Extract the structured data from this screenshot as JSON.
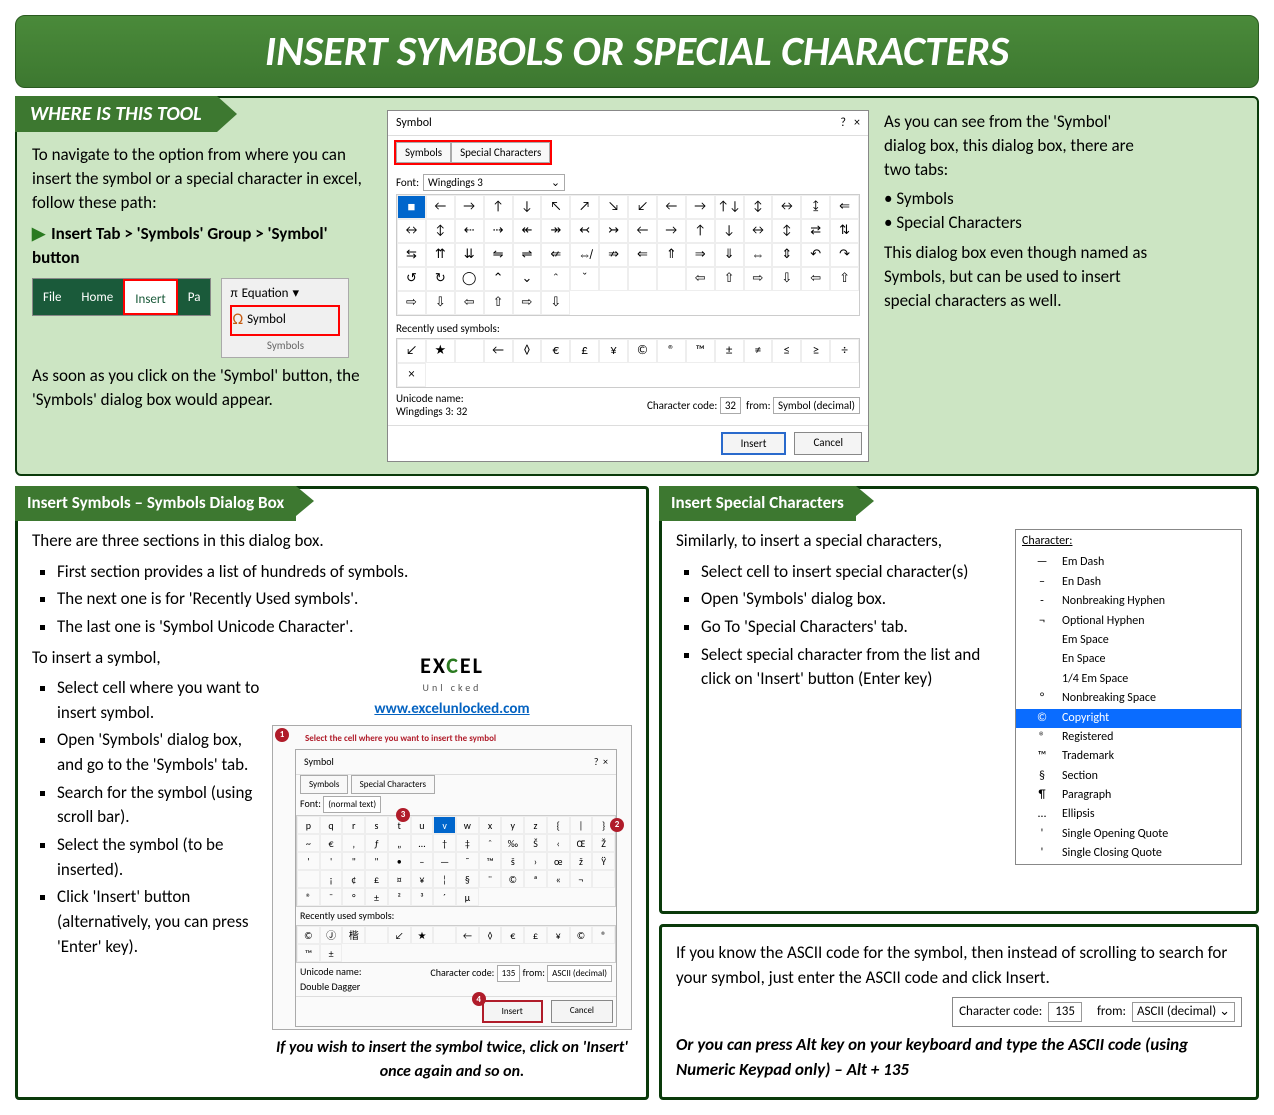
{
  "title": "INSERT SYMBOLS OR SPECIAL CHARACTERS",
  "where": {
    "header": "WHERE IS THIS TOOL",
    "intro": "To navigate to the option from where you can insert the symbol or a special character in excel, follow these path:",
    "path": "Insert Tab > 'Symbols' Group > 'Symbol' button",
    "after": "As soon as you click on the 'Symbol' button, the 'Symbols' dialog box would appear.",
    "ribbon": {
      "file": "File",
      "home": "Home",
      "insert": "Insert",
      "pa": "Pa"
    },
    "group": {
      "equation": "Equation",
      "symbol": "Symbol",
      "label": "Symbols",
      "pi": "π",
      "omega": "Ω"
    },
    "right_intro": "As you can see from the 'Symbol' dialog box, this dialog box, there are two tabs:",
    "bullets": [
      "Symbols",
      "Special Characters"
    ],
    "right_after": "This dialog box even though named as Symbols, but can be used to insert special characters as well."
  },
  "dialog": {
    "title": "Symbol",
    "help": "?",
    "close": "×",
    "tab1": "Symbols",
    "tab2": "Special Characters",
    "font_label": "Font:",
    "font_value": "Wingdings 3",
    "grid": [
      "■",
      "←",
      "→",
      "↑",
      "↓",
      "↖",
      "↗",
      "↘",
      "↙",
      "←",
      "→",
      "↑↓",
      "↕",
      "↔",
      "↨",
      "⇐",
      "↔",
      "↕",
      "⇠",
      "⇢",
      "↞",
      "↠",
      "↢",
      "↣",
      "←",
      "→",
      "↑",
      "↓",
      "↔",
      "↕",
      "⇄",
      "⇅",
      "⇆",
      "⇈",
      "⇊",
      "⇋",
      "⇌",
      "⇍",
      "⇎",
      "⇏",
      "⇐",
      "⇑",
      "⇒",
      "⇓",
      "⇔",
      "⇕",
      "↶",
      "↷",
      "↺",
      "↻",
      "◯",
      "⌃",
      "⌄",
      "＾",
      "ˇ",
      "",
      "",
      "",
      "⇦",
      "⇧",
      "⇨",
      "⇩",
      "⇦",
      "⇧",
      "⇨",
      "⇩",
      "⇦",
      "⇧",
      "⇨",
      "⇩"
    ],
    "recent_label": "Recently used symbols:",
    "recent": [
      "↙",
      "★",
      "",
      "←",
      "◊",
      "€",
      "£",
      "¥",
      "©",
      "®",
      "™",
      "±",
      "≠",
      "≤",
      "≥",
      "÷",
      "×"
    ],
    "uni_label": "Unicode name:",
    "uni_value": "Wingdings 3: 32",
    "cc_label": "Character code:",
    "cc_value": "32",
    "from_label": "from:",
    "from_value": "Symbol (decimal)",
    "insert": "Insert",
    "cancel": "Cancel"
  },
  "left_panel": {
    "header": "Insert Symbols – Symbols Dialog Box",
    "p1": "There are three sections in this dialog box.",
    "bullets1": [
      "First section provides a list of hundreds of symbols.",
      "The next one is for 'Recently Used symbols'.",
      "The last one is 'Symbol Unicode Character'."
    ],
    "p2": "To insert a symbol,",
    "bullets2": [
      "Select cell where you want to insert symbol.",
      "Open 'Symbols' dialog box, and go to the 'Symbols' tab.",
      "Search for the symbol (using scroll bar).",
      "Select the symbol (to be inserted).",
      "Click 'Insert' button (alternatively, you can press 'Enter' key)."
    ],
    "logo_top": "EXCEL",
    "logo_sub": "Unl  cked",
    "logo_url": "www.excelunlocked.com",
    "sheet_instruction": "Select the cell where you want to insert the symbol",
    "mini": {
      "font_label": "Font:",
      "font_value": "(normal text)",
      "row1": [
        "p",
        "q",
        "r",
        "s",
        "t",
        "u",
        "v",
        "w",
        "x",
        "y",
        "z",
        "{",
        "|",
        "}",
        "~",
        "€"
      ],
      "row2": [
        "‚",
        "ƒ",
        "„",
        "…",
        "†",
        "‡",
        "ˆ",
        "‰",
        "Š",
        "‹",
        "Œ",
        "Ž",
        "'",
        "'",
        "\"",
        "\""
      ],
      "row3": [
        "•",
        "–",
        "—",
        "˜",
        "™",
        "š",
        "›",
        "œ",
        "ž",
        "Ÿ",
        "",
        "¡",
        "¢",
        "£",
        "¤",
        "¥"
      ],
      "row4": [
        "¦",
        "§",
        "¨",
        "©",
        "ª",
        "«",
        "¬",
        "",
        "®",
        "¯",
        "°",
        "±",
        "²",
        "³",
        "´",
        "µ"
      ],
      "recent": [
        "©",
        "Ⓙ",
        "楷",
        "",
        "↙",
        "★",
        "",
        "←",
        "◊",
        "€",
        "£",
        "¥",
        "©",
        "®",
        "™",
        "±"
      ],
      "uni": "Double Dagger",
      "cc": "135",
      "from": "ASCII (decimal)"
    },
    "caption": "If you wish to insert the symbol twice, click on 'Insert' once again and so on."
  },
  "right_top": {
    "header": "Insert Special Characters",
    "p1": "Similarly, to insert a special characters,",
    "bullets": [
      "Select cell to insert special character(s)",
      "Open 'Symbols' dialog box.",
      "Go To 'Special Characters' tab.",
      "Select special character from the list and click on 'Insert' button (Enter key)"
    ],
    "list_header": "Character:",
    "chars": [
      {
        "s": "—",
        "n": "Em Dash"
      },
      {
        "s": "–",
        "n": "En Dash"
      },
      {
        "s": "-",
        "n": "Nonbreaking Hyphen"
      },
      {
        "s": "¬",
        "n": "Optional Hyphen"
      },
      {
        "s": "",
        "n": "Em Space"
      },
      {
        "s": "",
        "n": "En Space"
      },
      {
        "s": "",
        "n": "1/4 Em Space"
      },
      {
        "s": "°",
        "n": "Nonbreaking Space"
      },
      {
        "s": "©",
        "n": "Copyright"
      },
      {
        "s": "®",
        "n": "Registered"
      },
      {
        "s": "™",
        "n": "Trademark"
      },
      {
        "s": "§",
        "n": "Section"
      },
      {
        "s": "¶",
        "n": "Paragraph"
      },
      {
        "s": "…",
        "n": "Ellipsis"
      },
      {
        "s": "'",
        "n": "Single Opening Quote"
      },
      {
        "s": "'",
        "n": "Single Closing Quote"
      }
    ]
  },
  "right_bottom": {
    "p1": "If you know the ASCII code for the symbol, then instead of scrolling to search for your symbol, just enter the ASCII code and click Insert.",
    "cc_label": "Character code:",
    "cc_value": "135",
    "from_label": "from:",
    "from_value": "ASCII (decimal)",
    "p2": "Or you can press Alt key on your keyboard and type the ASCII code (using Numeric Keypad only) – Alt + 135"
  }
}
